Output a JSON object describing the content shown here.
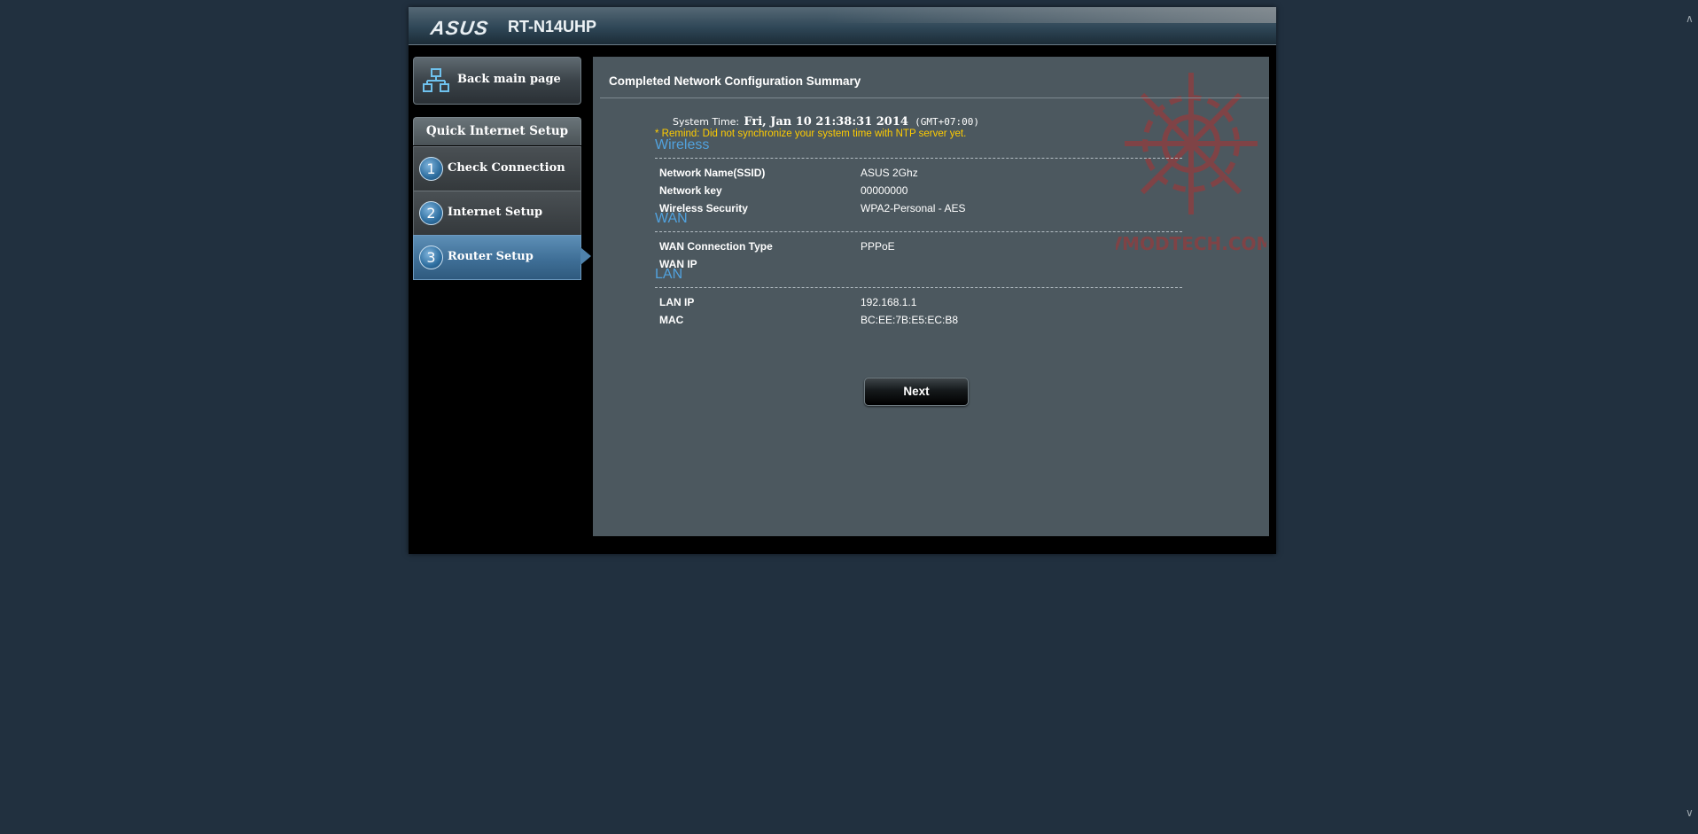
{
  "header": {
    "brand": "ASUS",
    "model": "RT-N14UHP"
  },
  "nav": {
    "back_label": "Back main page",
    "section_title": "Quick Internet Setup",
    "steps": [
      {
        "number": "1",
        "label": "Check Connection"
      },
      {
        "number": "2",
        "label": "Internet Setup"
      },
      {
        "number": "3",
        "label": "Router Setup"
      }
    ],
    "active_step": "3"
  },
  "content": {
    "title": "Completed Network Configuration Summary",
    "system_time_label": "System Time:",
    "system_time_value": "Fri, Jan 10 21:38:31 2014",
    "system_time_tz": "(GMT+07:00)",
    "remind": "* Remind: Did not synchronize your system time with NTP server yet.",
    "wireless": {
      "title": "Wireless",
      "rows": [
        {
          "label": "Network Name(SSID)",
          "value": "ASUS 2Ghz"
        },
        {
          "label": "Network key",
          "value": "00000000"
        },
        {
          "label": "Wireless Security",
          "value": "WPA2-Personal - AES"
        }
      ]
    },
    "wan": {
      "title": "WAN",
      "rows": [
        {
          "label": "WAN Connection Type",
          "value": "PPPoE"
        },
        {
          "label": "WAN IP",
          "value": ""
        }
      ]
    },
    "lan": {
      "title": "LAN",
      "rows": [
        {
          "label": "LAN IP",
          "value": "192.168.1.1"
        },
        {
          "label": "MAC",
          "value": "BC:EE:7B:E5:EC:B8"
        }
      ]
    },
    "next_label": "Next"
  },
  "colors": {
    "page_bg": "#21303f",
    "panel_bg": "#4c585f",
    "section_title": "#51a2de",
    "remind": "#ffcc00",
    "active_step": "#4f82ab"
  }
}
